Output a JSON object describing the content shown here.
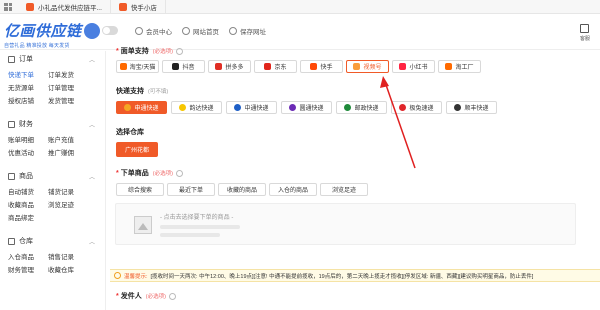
{
  "browser_tabs": [
    {
      "label": "小礼品代发供应链平...",
      "color": "#f05a28"
    },
    {
      "label": "快手小店",
      "color": "#f05a28"
    }
  ],
  "header": {
    "logo": "亿画供应链",
    "tagline": "自营礼品  精准投放  每天发货",
    "nav": [
      {
        "label": "会员中心",
        "icon": "diamond-icon"
      },
      {
        "label": "网站首页",
        "icon": "home-icon"
      },
      {
        "label": "保存网址",
        "icon": "save-icon"
      }
    ],
    "right_label": "客服"
  },
  "sidebar": {
    "groups": [
      {
        "title": "订单",
        "icon": "order-icon",
        "rows": [
          [
            "快递下单",
            "订单发货"
          ],
          [
            "无货源单",
            "订单管理"
          ],
          [
            "授权店铺",
            "发货管理"
          ]
        ]
      },
      {
        "title": "财务",
        "icon": "finance-icon",
        "rows": [
          [
            "账单明细",
            "账户充值"
          ],
          [
            "优惠活动",
            "推广赚佣"
          ]
        ]
      },
      {
        "title": "商品",
        "icon": "goods-icon",
        "rows": [
          [
            "自动铺货",
            "铺货记录"
          ],
          [
            "收藏商品",
            "浏览足迹"
          ],
          [
            "商品绑定",
            ""
          ]
        ]
      },
      {
        "title": "仓库",
        "icon": "warehouse-icon",
        "rows": [
          [
            "入仓商品",
            "销售记录"
          ],
          [
            "财务管理",
            "收藏仓库"
          ]
        ]
      }
    ],
    "active_item": "快递下单"
  },
  "platform": {
    "title": "面单支持",
    "hint": "(必选项)",
    "options": [
      {
        "label": "淘宝/天猫",
        "color": "#ff6a00",
        "selected": false
      },
      {
        "label": "抖音",
        "color": "#222222",
        "selected": false
      },
      {
        "label": "拼多多",
        "color": "#e02e24",
        "selected": false
      },
      {
        "label": "京东",
        "color": "#e1251b",
        "selected": false
      },
      {
        "label": "快手",
        "color": "#ff4906",
        "selected": false
      },
      {
        "label": "视频号",
        "color": "#fa9d3b",
        "selected": true
      },
      {
        "label": "小红书",
        "color": "#ff2442",
        "selected": false
      },
      {
        "label": "淘工厂",
        "color": "#ff6a00",
        "selected": false
      }
    ]
  },
  "express": {
    "title": "快递支持",
    "hint": "(可不填)",
    "options": [
      {
        "label": "申通快递",
        "color": "#f5a623",
        "selected": true
      },
      {
        "label": "韵达快递",
        "color": "#f7c600",
        "selected": false
      },
      {
        "label": "中通快递",
        "color": "#1f5fc6",
        "selected": false
      },
      {
        "label": "圆通快递",
        "color": "#6b2bb5",
        "selected": false
      },
      {
        "label": "邮政快递",
        "color": "#1f8a3a",
        "selected": false
      },
      {
        "label": "极兔速递",
        "color": "#e0262b",
        "selected": false
      },
      {
        "label": "顺丰快递",
        "color": "#333333",
        "selected": false
      }
    ]
  },
  "warehouse": {
    "title": "选择仓库",
    "options": [
      {
        "label": "广州花都",
        "selected": true
      }
    ]
  },
  "goods": {
    "title": "下单商品",
    "hint": "(必选项)",
    "tabs": [
      "综合搜索",
      "最近下单",
      "收藏的商品",
      "入仓的商品",
      "浏览足迹"
    ],
    "placeholder": "- 点击去选择要下单的商品 -"
  },
  "notice": {
    "label": "温馨提示:",
    "text": "[揽收时间一天两次: 中午12:00、晚上19点][注意! 中通不能提前揽收，19点后的，第二天晚上揽走才揽收][停发区域: 新疆、西藏][建议购买明星商品，防止丢件]"
  },
  "sender": {
    "title": "发件人",
    "hint": "(必选项)"
  }
}
